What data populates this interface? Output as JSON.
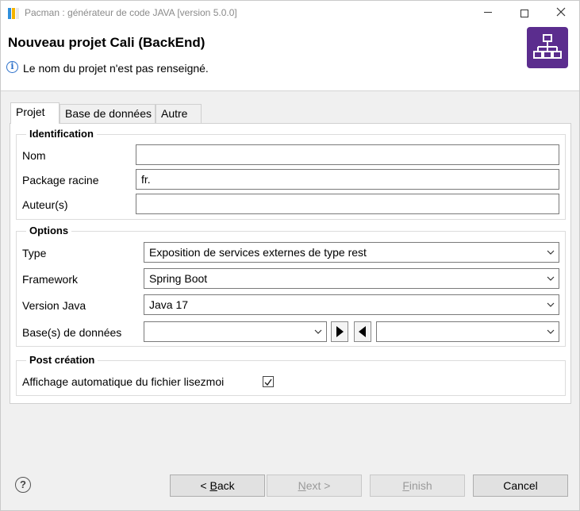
{
  "window": {
    "title": "Pacman : générateur de code JAVA [version 5.0.0]",
    "controls": {
      "minimize": "—",
      "maximize": "",
      "close": "✕"
    }
  },
  "header": {
    "title": "Nouveau projet Cali (BackEnd)",
    "message": "Le nom du projet n'est pas renseigné.",
    "banner_icon": "hierarchy-diagram-icon",
    "banner_color": "#5b2d8e"
  },
  "tabs": [
    {
      "label": "Projet",
      "active": true
    },
    {
      "label": "Base de données",
      "active": false
    },
    {
      "label": "Autre",
      "active": false
    }
  ],
  "identification": {
    "legend": "Identification",
    "nom": {
      "label": "Nom",
      "value": ""
    },
    "package": {
      "label": "Package racine",
      "value": "fr."
    },
    "auteurs": {
      "label": "Auteur(s)",
      "value": ""
    }
  },
  "options": {
    "legend": "Options",
    "type": {
      "label": "Type",
      "value": "Exposition de services externes de type rest"
    },
    "framework": {
      "label": "Framework",
      "value": "Spring Boot"
    },
    "java": {
      "label": "Version Java",
      "value": "Java 17"
    },
    "bases": {
      "label": "Base(s) de données",
      "left_value": "",
      "right_value": ""
    }
  },
  "post": {
    "legend": "Post création",
    "readme": {
      "label": "Affichage automatique du fichier lisezmoi",
      "checked": true
    }
  },
  "footer": {
    "help_icon": "help-icon",
    "back_mn": "<",
    "back_pre": " ",
    "back_u": "B",
    "back_post": "ack",
    "next_pre": "",
    "next_u": "N",
    "next_post": "ext >",
    "finish_pre": "",
    "finish_u": "F",
    "finish_post": "inish",
    "cancel": "Cancel"
  }
}
